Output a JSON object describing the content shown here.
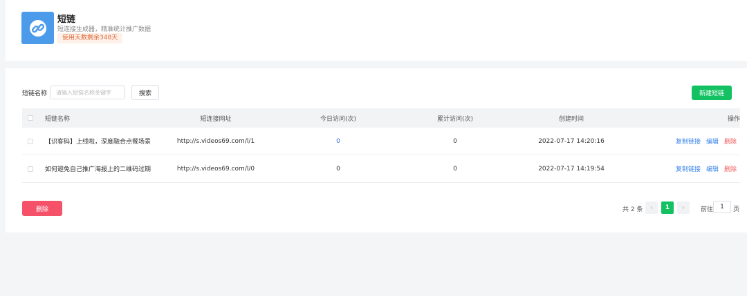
{
  "app": {
    "title": "短链",
    "description": "短连接生成器，精准统计推广数据",
    "usage_badge": "使用天数剩余348天",
    "logo_icon": "link-icon",
    "logo_color": "#4c9aea"
  },
  "filter": {
    "label": "短链名称",
    "placeholder": "请输入短链名称关键字",
    "search_label": "搜索",
    "new_label": "新建短链"
  },
  "table": {
    "headers": {
      "name": "短链名称",
      "url": "短连接网址",
      "today": "今日访问(次)",
      "total": "累计访问(次)",
      "created": "创建时间",
      "actions": "操作"
    },
    "rows": [
      {
        "name": "【识客码】上线啦，深度融合点餐场景",
        "url": "http://s.videos69.com/l/1",
        "today": "0",
        "total": "0",
        "created": "2022-07-17 14:20:16"
      },
      {
        "name": "如何避免自己推广海报上的二维码过期",
        "url": "http://s.videos69.com/l/0",
        "today": "0",
        "total": "0",
        "created": "2022-07-17 14:19:54"
      }
    ],
    "actions": {
      "copy": "复制链接",
      "edit": "编辑",
      "delete": "删除"
    }
  },
  "footer": {
    "delete_label": "删除",
    "total_text": "共 2 条",
    "current_page": "1",
    "goto_label": "前往",
    "goto_value": "1",
    "page_unit": "页"
  },
  "colors": {
    "accent_green": "#14c162",
    "danger_red": "#f5526a",
    "link_blue": "#3d86ea"
  }
}
